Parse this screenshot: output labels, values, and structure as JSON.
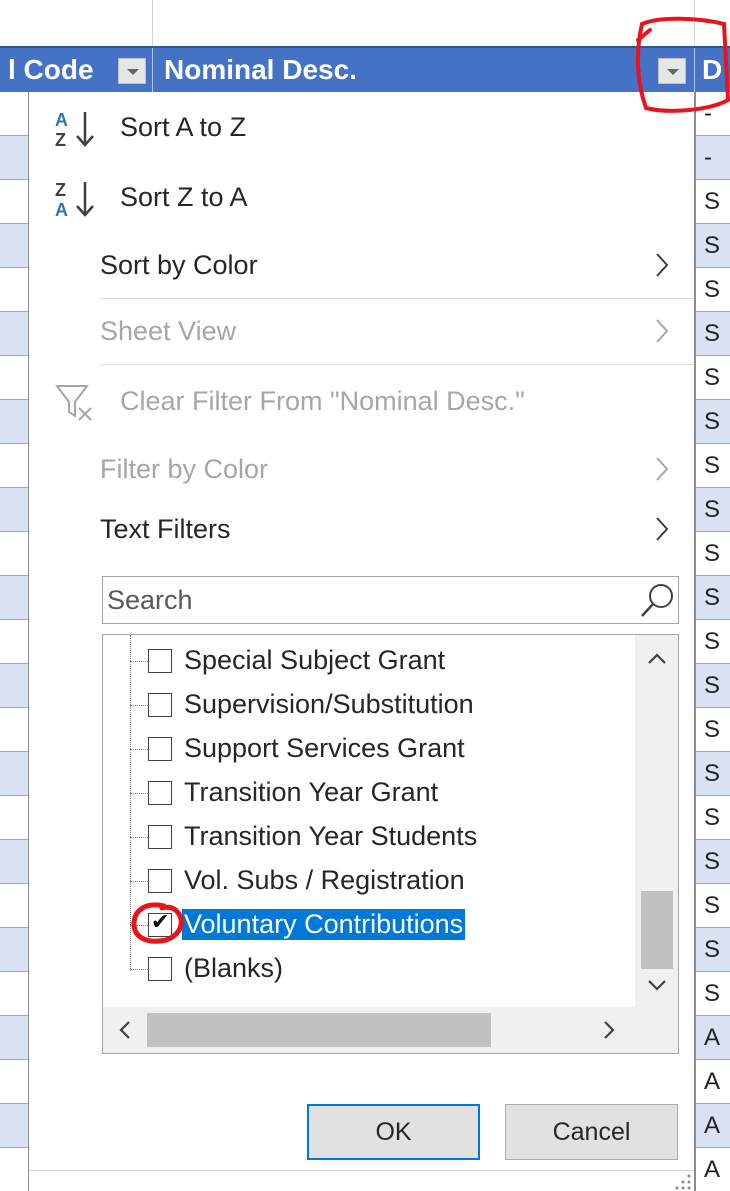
{
  "header": {
    "col_code_label": "l Code",
    "col_desc_label": "Nominal Desc."
  },
  "menu": {
    "sort_az": "Sort A to Z",
    "sort_za": "Sort Z to A",
    "sort_by_color": "Sort by Color",
    "sheet_view": "Sheet View",
    "clear_filter": "Clear Filter From \"Nominal Desc.\"",
    "filter_by_color": "Filter by Color",
    "text_filters": "Text Filters"
  },
  "search": {
    "placeholder": "Search"
  },
  "filter_list": {
    "items": [
      {
        "label": "Special Subject Grant",
        "checked": false
      },
      {
        "label": "Supervision/Substitution",
        "checked": false
      },
      {
        "label": "Support Services Grant",
        "checked": false
      },
      {
        "label": "Transition Year Grant",
        "checked": false
      },
      {
        "label": "Transition Year Students",
        "checked": false
      },
      {
        "label": "Vol. Subs / Registration",
        "checked": false
      },
      {
        "label": "Voluntary Contributions",
        "checked": true
      },
      {
        "label": "(Blanks)",
        "checked": false
      }
    ]
  },
  "buttons": {
    "ok": "OK",
    "cancel": "Cancel"
  },
  "sheet_tail_chars": [
    "-",
    "-",
    "S",
    "S",
    "S",
    "S",
    "S",
    "S",
    "S",
    "S",
    "S",
    "S",
    "S",
    "S",
    "S",
    "S",
    "S",
    "S",
    "S",
    "S",
    "S",
    "A",
    "A",
    "A",
    "A"
  ],
  "colors": {
    "header_bg": "#4472c4",
    "row_band": "#d9e1f2",
    "selection": "#0078d7",
    "annotation": "#e8141c"
  }
}
